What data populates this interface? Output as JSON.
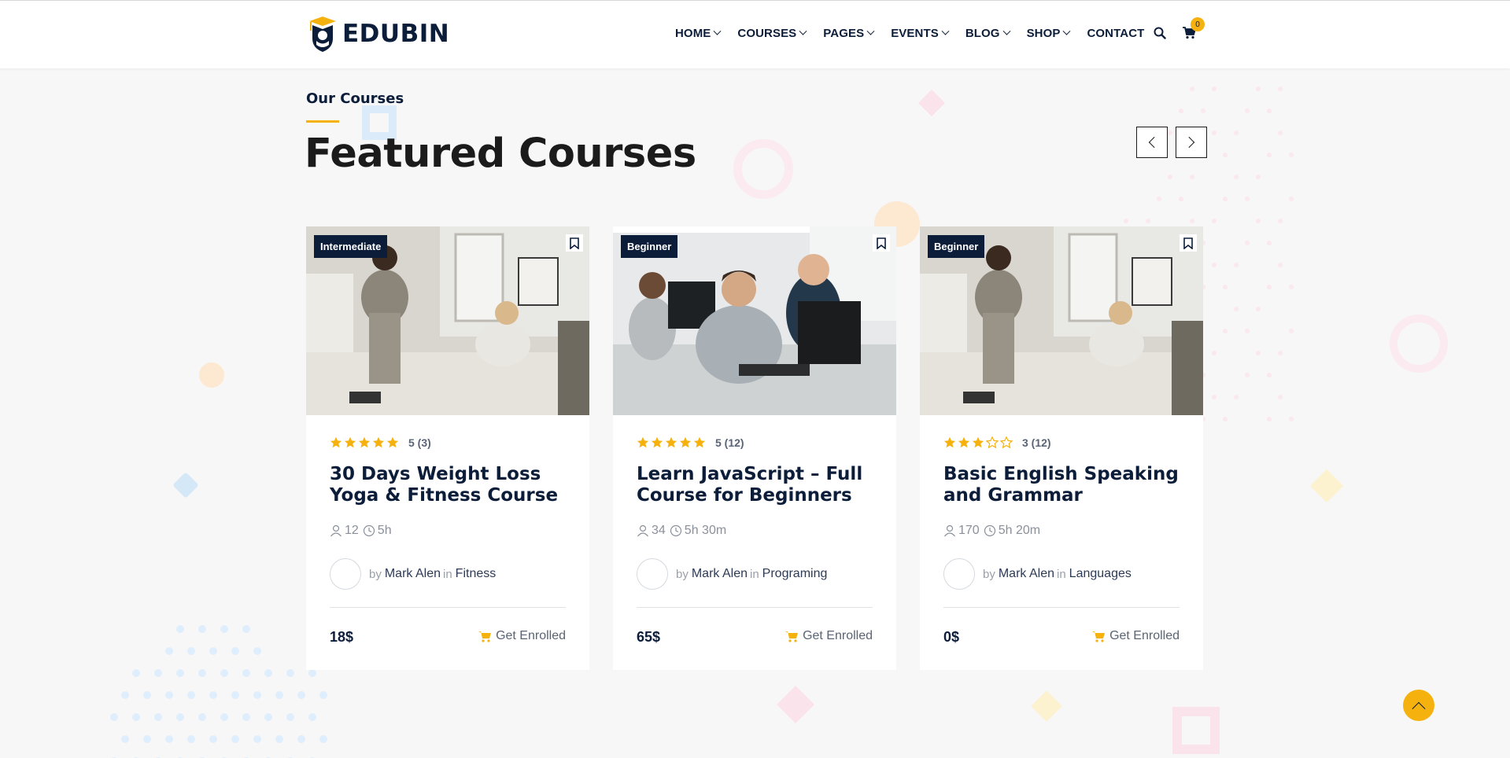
{
  "header": {
    "logo_text": "EDUBIN",
    "nav": [
      {
        "label": "HOME",
        "dropdown": true
      },
      {
        "label": "COURSES",
        "dropdown": true
      },
      {
        "label": "PAGES",
        "dropdown": true
      },
      {
        "label": "EVENTS",
        "dropdown": true
      },
      {
        "label": "BLOG",
        "dropdown": true
      },
      {
        "label": "SHOP",
        "dropdown": true
      },
      {
        "label": "CONTACT",
        "dropdown": false
      }
    ],
    "cart_count": "0"
  },
  "section": {
    "eyebrow": "Our Courses",
    "title": "Featured Courses"
  },
  "courses": [
    {
      "level": "Intermediate",
      "rating_text": "5 (3)",
      "stars": 5,
      "title": "30 Days Weight Loss Yoga & Fitness Course",
      "students": "12",
      "duration": "5h",
      "by": "by",
      "author": "Mark Alen",
      "in": "in",
      "category": "Fitness",
      "price": "18$",
      "enroll": "Get Enrolled"
    },
    {
      "level": "Beginner",
      "rating_text": "5 (12)",
      "stars": 5,
      "title": "Learn JavaScript – Full Course for Beginners",
      "students": "34",
      "duration": "5h 30m",
      "by": "by",
      "author": "Mark Alen",
      "in": "in",
      "category": "Programing",
      "price": "65$",
      "enroll": "Get Enrolled"
    },
    {
      "level": "Beginner",
      "rating_text": "3 (12)",
      "stars": 3,
      "title": "Basic English Speaking and Grammar",
      "students": "170",
      "duration": "5h 20m",
      "by": "by",
      "author": "Mark Alen",
      "in": "in",
      "category": "Languages",
      "price": "0$",
      "enroll": "Get Enrolled"
    }
  ],
  "colors": {
    "accent": "#f5b20f",
    "navy": "#0c1d3a",
    "background": "#f7f7f7"
  }
}
